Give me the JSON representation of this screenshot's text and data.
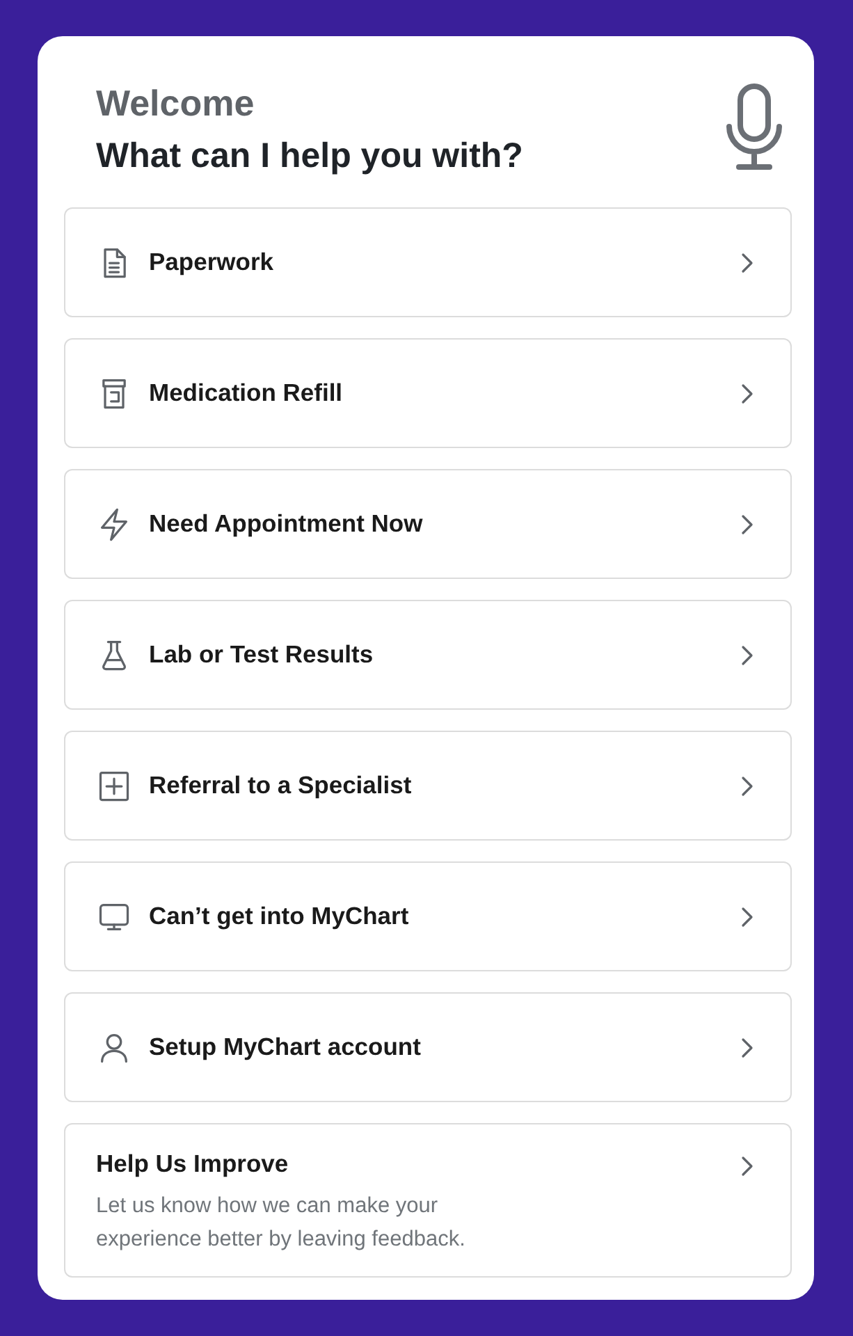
{
  "header": {
    "greeting": "Welcome",
    "title": "What can I help you with?"
  },
  "options": [
    {
      "label": "Paperwork"
    },
    {
      "label": "Medication Refill"
    },
    {
      "label": "Need Appointment Now"
    },
    {
      "label": "Lab or Test Results"
    },
    {
      "label": "Referral to a Specialist"
    },
    {
      "label": "Can’t get into MyChart"
    },
    {
      "label": "Setup MyChart account"
    }
  ],
  "feedback": {
    "title": "Help Us Improve",
    "description": "Let us know how we can make your experience better by leaving feedback."
  }
}
